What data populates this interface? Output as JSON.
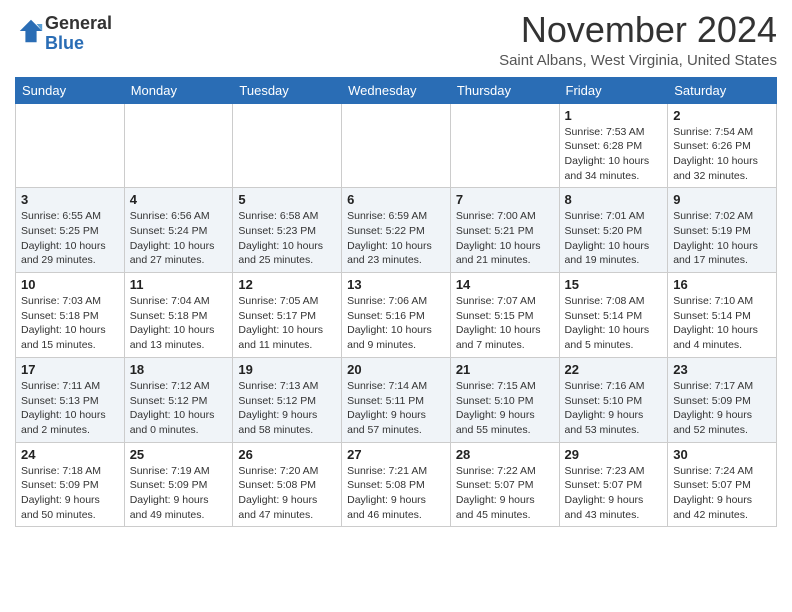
{
  "header": {
    "logo_general": "General",
    "logo_blue": "Blue",
    "month": "November 2024",
    "location": "Saint Albans, West Virginia, United States"
  },
  "weekdays": [
    "Sunday",
    "Monday",
    "Tuesday",
    "Wednesday",
    "Thursday",
    "Friday",
    "Saturday"
  ],
  "weeks": [
    [
      {
        "day": "",
        "info": ""
      },
      {
        "day": "",
        "info": ""
      },
      {
        "day": "",
        "info": ""
      },
      {
        "day": "",
        "info": ""
      },
      {
        "day": "",
        "info": ""
      },
      {
        "day": "1",
        "info": "Sunrise: 7:53 AM\nSunset: 6:28 PM\nDaylight: 10 hours and 34 minutes."
      },
      {
        "day": "2",
        "info": "Sunrise: 7:54 AM\nSunset: 6:26 PM\nDaylight: 10 hours and 32 minutes."
      }
    ],
    [
      {
        "day": "3",
        "info": "Sunrise: 6:55 AM\nSunset: 5:25 PM\nDaylight: 10 hours and 29 minutes."
      },
      {
        "day": "4",
        "info": "Sunrise: 6:56 AM\nSunset: 5:24 PM\nDaylight: 10 hours and 27 minutes."
      },
      {
        "day": "5",
        "info": "Sunrise: 6:58 AM\nSunset: 5:23 PM\nDaylight: 10 hours and 25 minutes."
      },
      {
        "day": "6",
        "info": "Sunrise: 6:59 AM\nSunset: 5:22 PM\nDaylight: 10 hours and 23 minutes."
      },
      {
        "day": "7",
        "info": "Sunrise: 7:00 AM\nSunset: 5:21 PM\nDaylight: 10 hours and 21 minutes."
      },
      {
        "day": "8",
        "info": "Sunrise: 7:01 AM\nSunset: 5:20 PM\nDaylight: 10 hours and 19 minutes."
      },
      {
        "day": "9",
        "info": "Sunrise: 7:02 AM\nSunset: 5:19 PM\nDaylight: 10 hours and 17 minutes."
      }
    ],
    [
      {
        "day": "10",
        "info": "Sunrise: 7:03 AM\nSunset: 5:18 PM\nDaylight: 10 hours and 15 minutes."
      },
      {
        "day": "11",
        "info": "Sunrise: 7:04 AM\nSunset: 5:18 PM\nDaylight: 10 hours and 13 minutes."
      },
      {
        "day": "12",
        "info": "Sunrise: 7:05 AM\nSunset: 5:17 PM\nDaylight: 10 hours and 11 minutes."
      },
      {
        "day": "13",
        "info": "Sunrise: 7:06 AM\nSunset: 5:16 PM\nDaylight: 10 hours and 9 minutes."
      },
      {
        "day": "14",
        "info": "Sunrise: 7:07 AM\nSunset: 5:15 PM\nDaylight: 10 hours and 7 minutes."
      },
      {
        "day": "15",
        "info": "Sunrise: 7:08 AM\nSunset: 5:14 PM\nDaylight: 10 hours and 5 minutes."
      },
      {
        "day": "16",
        "info": "Sunrise: 7:10 AM\nSunset: 5:14 PM\nDaylight: 10 hours and 4 minutes."
      }
    ],
    [
      {
        "day": "17",
        "info": "Sunrise: 7:11 AM\nSunset: 5:13 PM\nDaylight: 10 hours and 2 minutes."
      },
      {
        "day": "18",
        "info": "Sunrise: 7:12 AM\nSunset: 5:12 PM\nDaylight: 10 hours and 0 minutes."
      },
      {
        "day": "19",
        "info": "Sunrise: 7:13 AM\nSunset: 5:12 PM\nDaylight: 9 hours and 58 minutes."
      },
      {
        "day": "20",
        "info": "Sunrise: 7:14 AM\nSunset: 5:11 PM\nDaylight: 9 hours and 57 minutes."
      },
      {
        "day": "21",
        "info": "Sunrise: 7:15 AM\nSunset: 5:10 PM\nDaylight: 9 hours and 55 minutes."
      },
      {
        "day": "22",
        "info": "Sunrise: 7:16 AM\nSunset: 5:10 PM\nDaylight: 9 hours and 53 minutes."
      },
      {
        "day": "23",
        "info": "Sunrise: 7:17 AM\nSunset: 5:09 PM\nDaylight: 9 hours and 52 minutes."
      }
    ],
    [
      {
        "day": "24",
        "info": "Sunrise: 7:18 AM\nSunset: 5:09 PM\nDaylight: 9 hours and 50 minutes."
      },
      {
        "day": "25",
        "info": "Sunrise: 7:19 AM\nSunset: 5:09 PM\nDaylight: 9 hours and 49 minutes."
      },
      {
        "day": "26",
        "info": "Sunrise: 7:20 AM\nSunset: 5:08 PM\nDaylight: 9 hours and 47 minutes."
      },
      {
        "day": "27",
        "info": "Sunrise: 7:21 AM\nSunset: 5:08 PM\nDaylight: 9 hours and 46 minutes."
      },
      {
        "day": "28",
        "info": "Sunrise: 7:22 AM\nSunset: 5:07 PM\nDaylight: 9 hours and 45 minutes."
      },
      {
        "day": "29",
        "info": "Sunrise: 7:23 AM\nSunset: 5:07 PM\nDaylight: 9 hours and 43 minutes."
      },
      {
        "day": "30",
        "info": "Sunrise: 7:24 AM\nSunset: 5:07 PM\nDaylight: 9 hours and 42 minutes."
      }
    ]
  ]
}
